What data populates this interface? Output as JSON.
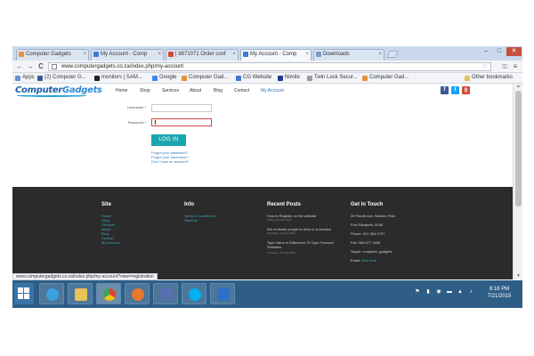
{
  "browser": {
    "tabs": [
      {
        "label": "Computer Gadgets",
        "color": "#e8903c"
      },
      {
        "label": "My Account - Comp",
        "color": "#3b7bd6"
      },
      {
        "label": "[ 8871071 Order conf",
        "color": "#d44a3a"
      },
      {
        "label": "My Account - Comp",
        "color": "#3b7bd6"
      },
      {
        "label": "Downloads",
        "color": "#7b9bc0"
      }
    ],
    "window_controls": {
      "minimize": "–",
      "maximize": "□",
      "close": "✕"
    },
    "back_icon": "←",
    "forward_icon": "→",
    "reload_icon": "C",
    "url": "www.computergadgets.co.za/index.php/my-account",
    "star_icon": "☆",
    "menu_icon": "≡",
    "bookmarks": [
      {
        "label": "Apps",
        "color": "#6a8fd0"
      },
      {
        "label": "(2) Computer G...",
        "color": "#3b5998"
      },
      {
        "label": "monitors | SAM...",
        "color": "#222"
      },
      {
        "label": "Google",
        "color": "#4285f4"
      },
      {
        "label": "Computer Gad...",
        "color": "#e8903c"
      },
      {
        "label": "CG Website",
        "color": "#3b7bd6"
      },
      {
        "label": "Nimite",
        "color": "#1b3c8c"
      },
      {
        "label": "Twin Lock Secur...",
        "color": "#999"
      },
      {
        "label": "Computer Gad...",
        "color": "#e8903c"
      }
    ],
    "other_bookmarks": "Other bookmarks",
    "status_url": "www.computergadgets.co.za/index.php/my-account?view=registration"
  },
  "site": {
    "logo_main": "Computer",
    "logo_accent": "Gadgets",
    "menu": [
      "Home",
      "Shop",
      "Services",
      "About",
      "Blog",
      "Contact",
      "My Account"
    ],
    "social": [
      {
        "icon": "f",
        "color": "#3b5998"
      },
      {
        "icon": "t",
        "color": "#1da1f2"
      },
      {
        "icon": "g",
        "color": "#d34836"
      }
    ]
  },
  "login": {
    "username_label": "Username *",
    "password_label": "Password *",
    "username_value": "",
    "password_value": "",
    "login_button": "LOG IN",
    "links": [
      "Forgot your password?",
      "Forgot your username?",
      "Don't have an account?"
    ]
  },
  "footer": {
    "site": {
      "title": "Site",
      "items": [
        "Home",
        "Shop",
        "Services",
        "About",
        "Blog",
        "Contact",
        "My Account"
      ]
    },
    "info": {
      "title": "Info",
      "items": [
        "Terms & Conditions",
        "Sitemap"
      ]
    },
    "recent_posts": {
      "title": "Recent Posts",
      "posts": [
        {
          "title": "How to Register on the website",
          "date": "Friday, 28 April 2015"
        },
        {
          "title": "We motivate people to think in a creative",
          "date": "Thursday, 23 April 2015"
        },
        {
          "title": "Type Value in Difference Of Type Focused Websites",
          "date": "Thursday, 23 April 2015"
        }
      ]
    },
    "get_in_touch": {
      "title": "Get In Touch",
      "lines": [
        "30 Fourth Ave, Newton Park",
        "Port Elizabeth, 6045",
        "Phone: 041 364 0737",
        "Fax: 086 677 3436",
        "Skype: computer_gadgets"
      ],
      "email_label": "Email:",
      "email_link": "click here"
    }
  },
  "taskbar": {
    "apps": [
      {
        "name": "internet-explorer",
        "color": "#3aa0e0"
      },
      {
        "name": "file-explorer",
        "color": "#e8c25a"
      },
      {
        "name": "chrome",
        "color": "#e0443a"
      },
      {
        "name": "firefox",
        "color": "#e8772e"
      },
      {
        "name": "skype",
        "color": "#00aff0"
      },
      {
        "name": "outlook",
        "color": "#2f6fc4"
      }
    ],
    "time": "8:18 PM",
    "date": "7/21/2015"
  }
}
